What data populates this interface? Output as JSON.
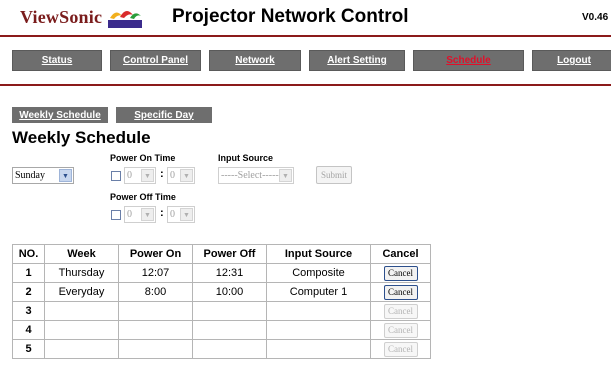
{
  "header": {
    "brand": "ViewSonic",
    "title": "Projector Network Control",
    "version": "V0.46"
  },
  "nav": [
    {
      "label": "Status",
      "active": false
    },
    {
      "label": "Control Panel",
      "active": false
    },
    {
      "label": "Network",
      "active": false
    },
    {
      "label": "Alert Setting",
      "active": false
    },
    {
      "label": "Schedule",
      "active": true
    },
    {
      "label": "Logout",
      "active": false
    }
  ],
  "subtabs": [
    "Weekly Schedule",
    "Specific Day"
  ],
  "section_title": "Weekly Schedule",
  "form": {
    "day_value": "Sunday",
    "power_on_label": "Power On Time",
    "power_off_label": "Power Off Time",
    "input_source_label": "Input Source",
    "on_hour": "0",
    "on_minute": "0",
    "off_hour": "0",
    "off_minute": "0",
    "separator": ":",
    "source_placeholder": "-----Select-----",
    "submit_label": "Submit"
  },
  "table": {
    "headers": [
      "NO.",
      "Week",
      "Power On",
      "Power Off",
      "Input Source",
      "Cancel"
    ],
    "rows": [
      {
        "no": "1",
        "week": "Thursday",
        "on": "12:07",
        "off": "12:31",
        "source": "Composite",
        "cancel": "Cancel",
        "enabled": true
      },
      {
        "no": "2",
        "week": "Everyday",
        "on": "8:00",
        "off": "10:00",
        "source": "Computer 1",
        "cancel": "Cancel",
        "enabled": true
      },
      {
        "no": "3",
        "week": "",
        "on": "",
        "off": "",
        "source": "",
        "cancel": "Cancel",
        "enabled": false
      },
      {
        "no": "4",
        "week": "",
        "on": "",
        "off": "",
        "source": "",
        "cancel": "Cancel",
        "enabled": false
      },
      {
        "no": "5",
        "week": "",
        "on": "",
        "off": "",
        "source": "",
        "cancel": "Cancel",
        "enabled": false
      }
    ]
  },
  "colors": {
    "brand": "#7a1c1c",
    "rule": "#8b1a1a",
    "nav_bg": "#6e6e6e",
    "active_tab": "#e0102a"
  }
}
